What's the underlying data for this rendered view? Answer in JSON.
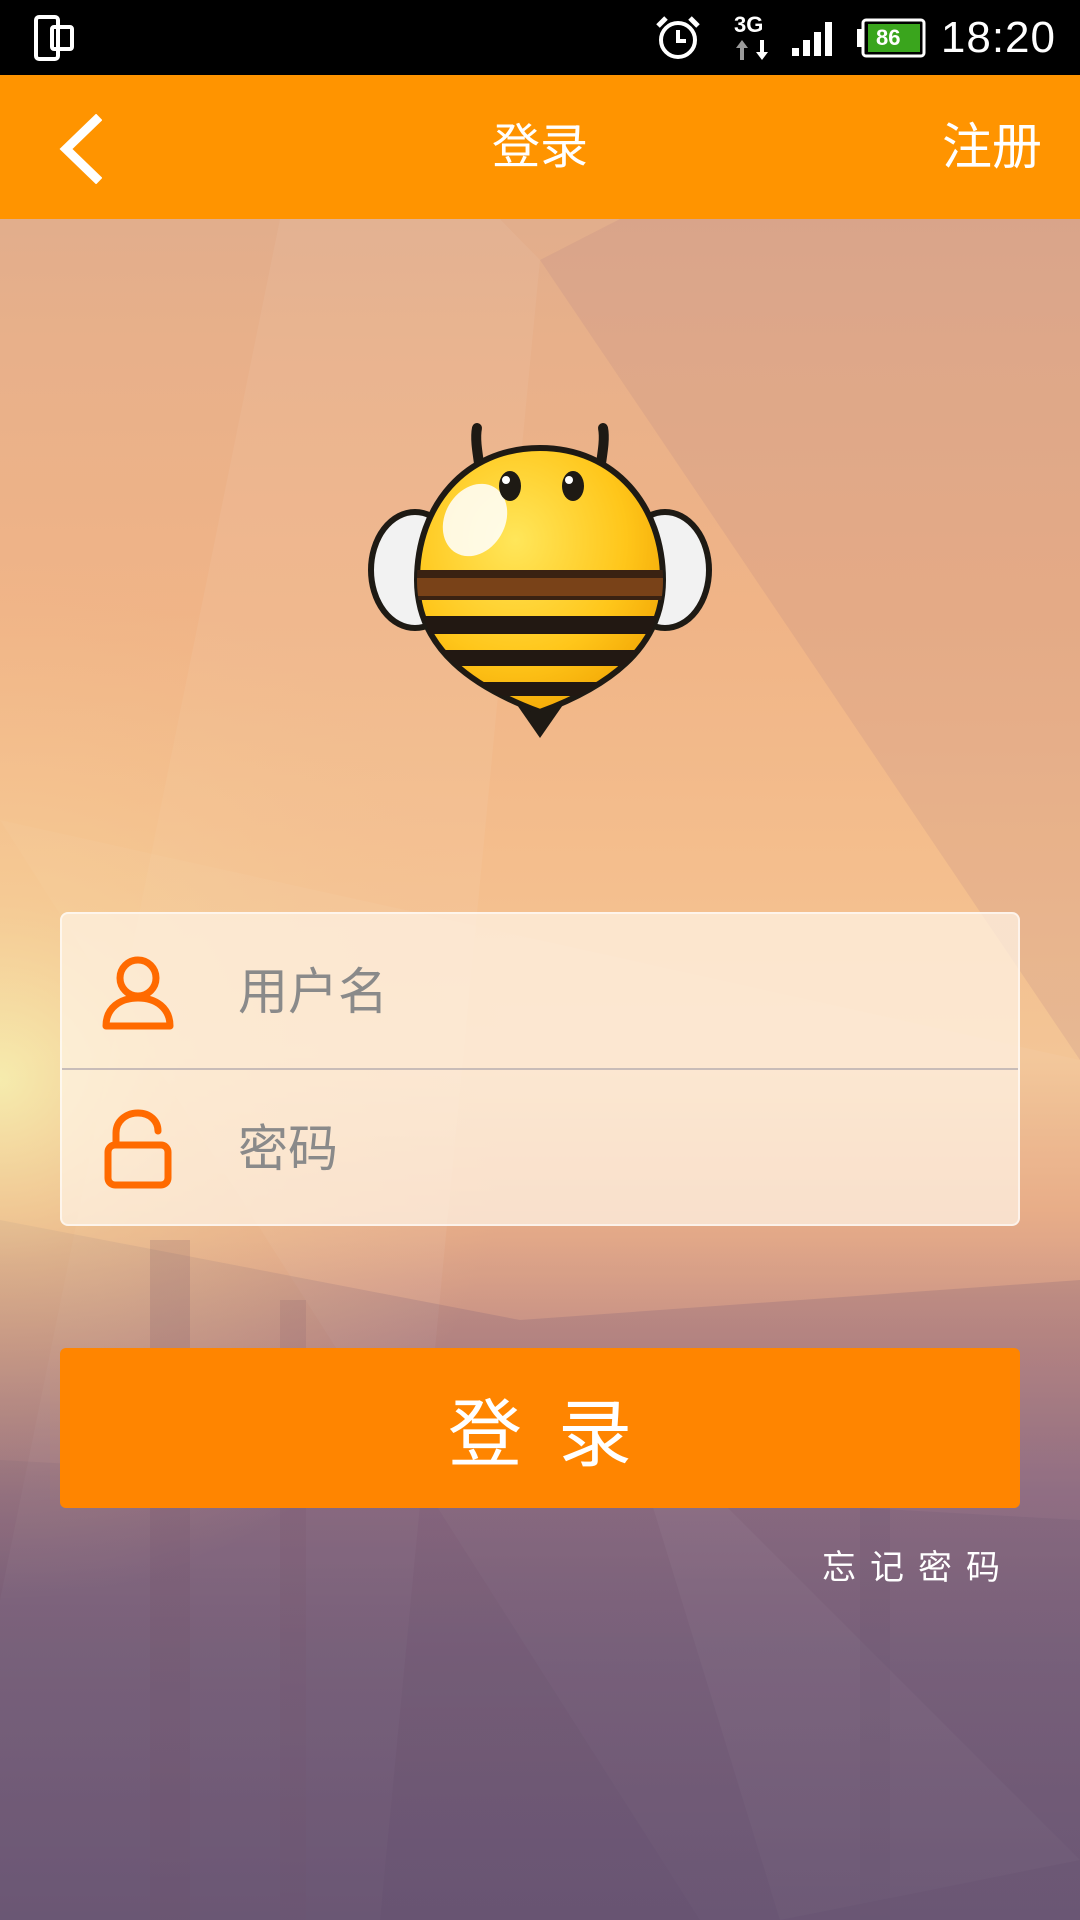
{
  "status_bar": {
    "time": "18:20",
    "battery_level": "86",
    "network_type": "3G",
    "icons": [
      "screen-rotation-icon",
      "alarm-icon",
      "network-3g-icon",
      "signal-icon",
      "battery-icon"
    ]
  },
  "title_bar": {
    "back_icon": "back-arrow-icon",
    "title": "登录",
    "register_label": "注册",
    "color": "#ff9400"
  },
  "logo": {
    "icon": "bee-mascot-icon"
  },
  "form": {
    "username": {
      "icon": "user-icon",
      "placeholder": "用户名",
      "value": ""
    },
    "password": {
      "icon": "lock-icon",
      "placeholder": "密码",
      "value": ""
    },
    "icon_color": "#ff6a00"
  },
  "actions": {
    "login_label": "登录",
    "forgot_password_label": "忘记密码",
    "button_color": "#ff8500"
  }
}
